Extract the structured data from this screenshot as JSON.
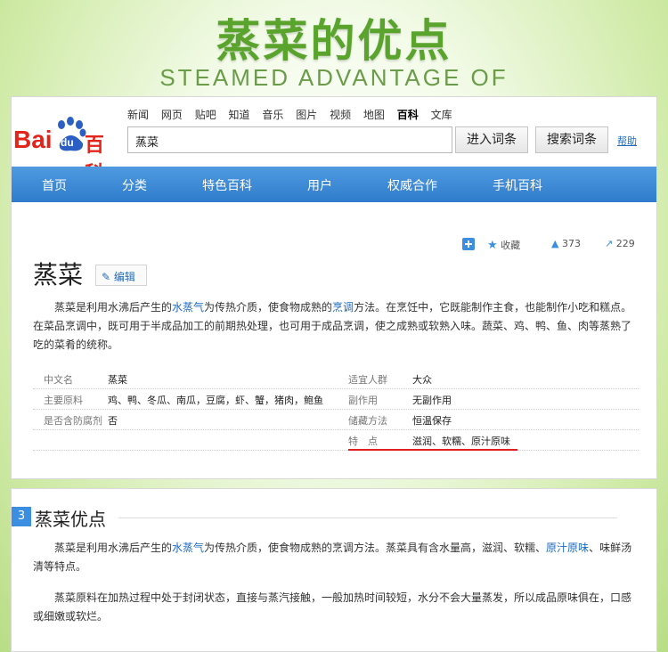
{
  "banner": {
    "title": "蒸菜的优点",
    "subtitle": "STEAMED ADVANTAGE OF"
  },
  "logo": {
    "text_bai": "Bai",
    "text_du": "du",
    "text_baike": "百科"
  },
  "top_nav": [
    "新闻",
    "网页",
    "贴吧",
    "知道",
    "音乐",
    "图片",
    "视频",
    "地图",
    "百科",
    "文库"
  ],
  "search": {
    "value": "蒸菜",
    "enter_button": "进入词条",
    "search_button": "搜索词条",
    "help": "帮助"
  },
  "main_nav": [
    "首页",
    "分类",
    "特色百科",
    "用户",
    "权威合作",
    "手机百科"
  ],
  "actions": {
    "collect": "收藏",
    "likes": "373",
    "shares": "229"
  },
  "entry": {
    "title": "蒸菜",
    "edit": "编辑",
    "intro_p1_a": "蒸菜是利用水沸后产生的",
    "intro_link1": "水蒸气",
    "intro_p1_b": "为传热介质，使食物成熟的",
    "intro_link2": "烹调",
    "intro_p1_c": "方法。在烹饪中，它既能制作主食，也能制作小吃和糕点。在菜品烹调中，既可用于半成品加工的前期热处理，也可用于成品烹调，使之成熟或软熟入味。蔬菜、鸡、鸭、鱼、肉等蒸熟了吃的菜肴的统称。"
  },
  "infobox": [
    {
      "k1": "中文名",
      "v1": "蒸菜",
      "k2": "适宜人群",
      "v2": "大众"
    },
    {
      "k1": "主要原料",
      "v1": "鸡、鸭、冬瓜、南瓜，豆腐，虾、蟹，猪肉，鲍鱼",
      "k2": "副作用",
      "v2": "无副作用"
    },
    {
      "k1": "是否含防腐剂",
      "v1": "否",
      "k2": "储藏方法",
      "v2": "恒温保存"
    },
    {
      "k1": "",
      "v1": "",
      "k2": "特　点",
      "v2": "滋润、软糯、原汁原味"
    }
  ],
  "section": {
    "number": "3",
    "title": "蒸菜优点",
    "p1_a": "蒸菜是利用水沸后产生的",
    "p1_link": "水蒸气",
    "p1_b": "为传热介质，使食物成熟的烹调方法。蒸菜具有含水量高，滋润、软糯、",
    "p1_link2": "原汁原味",
    "p1_c": "、味鲜汤清等特点。",
    "p2": "蒸菜原料在加热过程中处于封闭状态，直接与蒸汽接触，一般加热时间较短，水分不会大量蒸发，所以成品原味俱在，口感或细嫩或软烂。"
  }
}
